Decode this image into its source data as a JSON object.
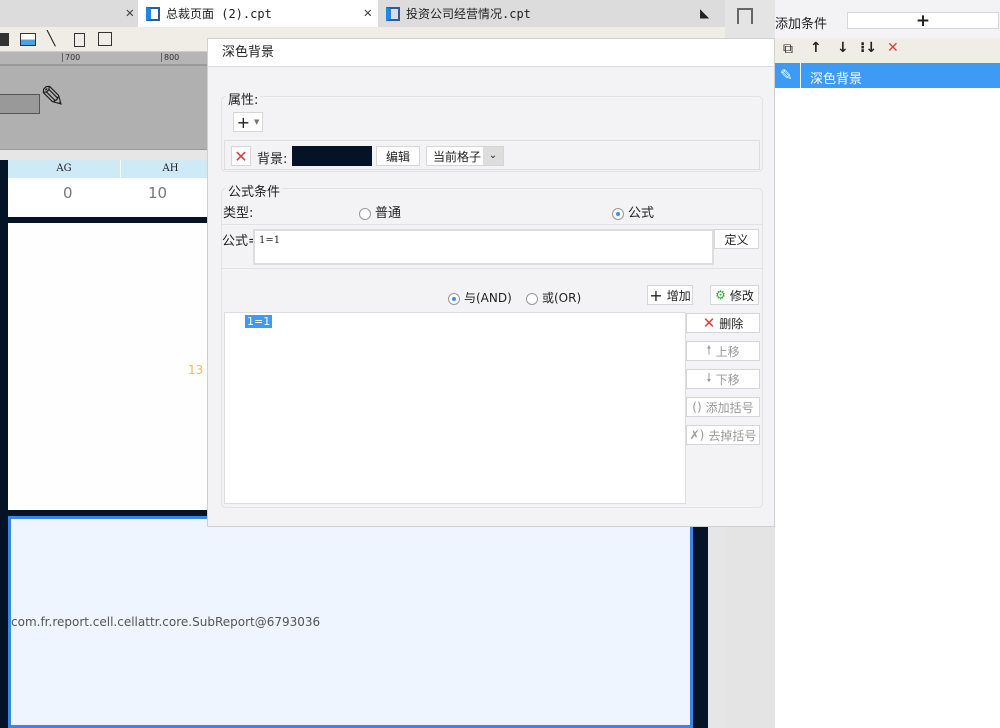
{
  "tabs": [
    {
      "label": "总裁页面 (2).cpt",
      "active": true
    },
    {
      "label": "投资公司经营情况.cpt",
      "active": false
    }
  ],
  "ruler": {
    "ticks": [
      "700",
      "800"
    ]
  },
  "columns": [
    "AG",
    "AH"
  ],
  "cells": {
    "ag": "0",
    "ah": "10",
    "stray": "13"
  },
  "subreport_text": "com.fr.report.cell.cellattr.core.SubReport@6793036",
  "dialog": {
    "title": "深色背景",
    "props_label": "属性:",
    "background_label": "背景:",
    "background_color": "#041426",
    "edit_label": "编辑",
    "scope_value": "当前格子",
    "formula_group_label": "公式条件",
    "type_label": "类型:",
    "type_options": [
      {
        "label": "普通",
        "selected": false
      },
      {
        "label": "公式",
        "selected": true
      }
    ],
    "formula_label": "公式=",
    "formula_value": "1=1",
    "define_label": "定义",
    "logic_options": [
      {
        "label": "与(AND)",
        "selected": true
      },
      {
        "label": "或(OR)",
        "selected": false
      }
    ],
    "add_label": "增加",
    "modify_label": "修改",
    "conditions": [
      "1=1"
    ],
    "side_buttons": [
      {
        "label": "删除",
        "enabled": true
      },
      {
        "label": "上移",
        "enabled": false
      },
      {
        "label": "下移",
        "enabled": false
      },
      {
        "label": "添加括号",
        "enabled": false
      },
      {
        "label": "去掉括号",
        "enabled": false
      }
    ]
  },
  "right_panel": {
    "add_condition_label": "添加条件",
    "items": [
      {
        "label": "深色背景",
        "selected": true
      }
    ]
  },
  "colors": {
    "accent": "#3d9af5",
    "dark_cell": "#041426"
  }
}
